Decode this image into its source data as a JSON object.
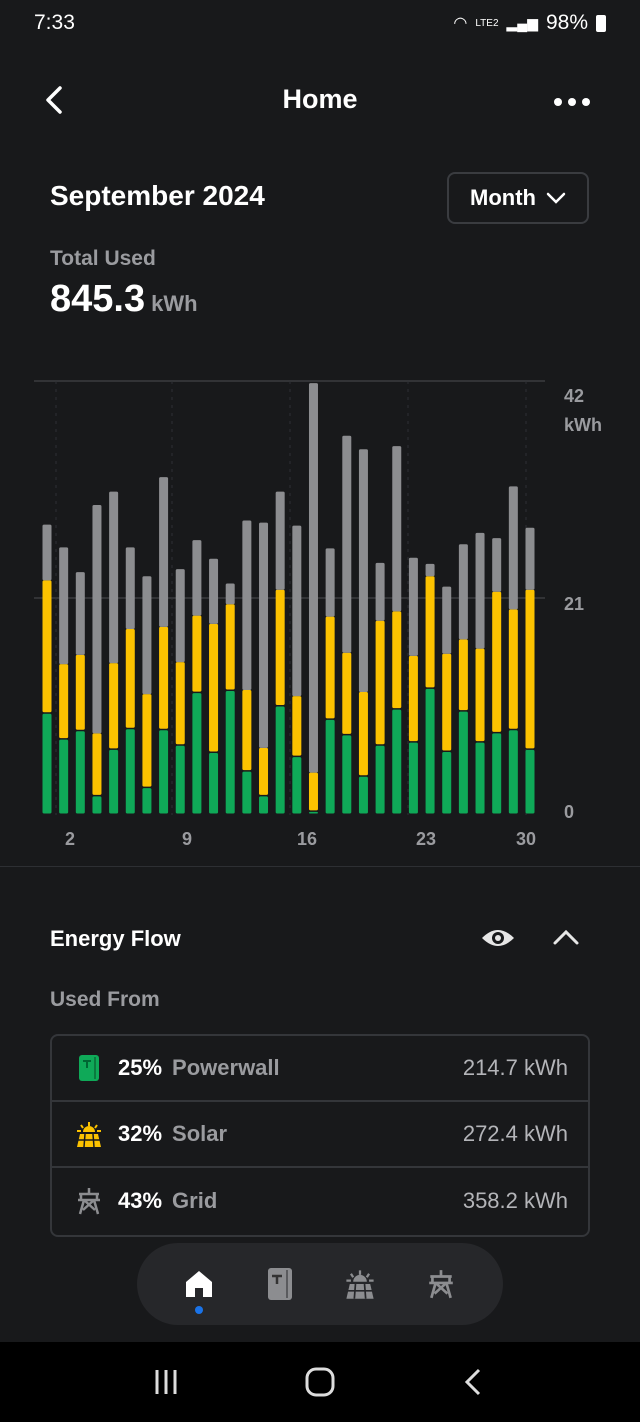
{
  "status_bar": {
    "time": "7:33",
    "battery": "98%",
    "network": "LTE2"
  },
  "header": {
    "title": "Home",
    "back_icon": "chevron-left-icon",
    "more_icon": "more-horizontal-icon"
  },
  "period": {
    "title": "September 2024",
    "range_select": "Month"
  },
  "total_used": {
    "label": "Total Used",
    "value": "845.3",
    "unit": "kWh"
  },
  "colors": {
    "powerwall": "#0fa958",
    "solar": "#fcc200",
    "grid": "#8c8d90",
    "accent": "#1a73e8",
    "background": "#18191b"
  },
  "chart_data": {
    "type": "bar",
    "stacked": true,
    "x": [
      1,
      2,
      3,
      4,
      5,
      6,
      7,
      8,
      9,
      10,
      11,
      12,
      13,
      14,
      15,
      16,
      17,
      18,
      19,
      20,
      21,
      22,
      23,
      24,
      25,
      26,
      27,
      28,
      29,
      30
    ],
    "x_tick_labels": [
      "2",
      "9",
      "16",
      "23",
      "30"
    ],
    "y_tick_labels": [
      "0",
      "21",
      "42"
    ],
    "y_unit": "kWh",
    "ylim": [
      0,
      42
    ],
    "grid": true,
    "series": [
      {
        "key": "powerwall",
        "values": [
          9.8,
          7.3,
          8.1,
          1.8,
          6.3,
          8.3,
          2.6,
          8.2,
          6.7,
          11.8,
          6.0,
          12.0,
          4.2,
          1.8,
          10.5,
          5.6,
          0.3,
          9.2,
          7.7,
          3.7,
          6.7,
          10.2,
          7.0,
          12.2,
          6.1,
          10.0,
          7.0,
          7.9,
          8.2,
          6.3
        ]
      },
      {
        "key": "solar",
        "values": [
          12.9,
          7.3,
          7.4,
          6.1,
          8.4,
          9.7,
          9.1,
          10.0,
          8.1,
          7.5,
          12.5,
          8.4,
          7.9,
          4.7,
          11.3,
          5.9,
          3.8,
          10.0,
          8.0,
          8.2,
          12.1,
          9.5,
          8.4,
          10.9,
          9.5,
          7.0,
          9.1,
          13.7,
          11.7,
          15.5
        ]
      },
      {
        "key": "grid",
        "values": [
          5.4,
          11.3,
          8.0,
          22.1,
          16.6,
          7.9,
          11.4,
          14.5,
          9.0,
          7.3,
          6.3,
          2.0,
          16.4,
          21.8,
          9.5,
          16.5,
          37.7,
          6.6,
          21.0,
          23.5,
          5.6,
          16.0,
          9.5,
          1.2,
          6.5,
          9.2,
          11.2,
          5.2,
          11.9,
          6.0
        ]
      }
    ]
  },
  "energy_flow": {
    "title": "Energy Flow",
    "used_from_label": "Used From",
    "sources": [
      {
        "icon": "powerwall-icon",
        "percent": "25%",
        "name": "Powerwall",
        "energy": "214.7 kWh"
      },
      {
        "icon": "solar-icon",
        "percent": "32%",
        "name": "Solar",
        "energy": "272.4 kWh"
      },
      {
        "icon": "grid-icon",
        "percent": "43%",
        "name": "Grid",
        "energy": "358.2 kWh"
      }
    ]
  },
  "bottom_nav": {
    "items": [
      "home-icon",
      "powerwall-icon",
      "solar-icon",
      "grid-icon"
    ],
    "active": "home-icon"
  }
}
